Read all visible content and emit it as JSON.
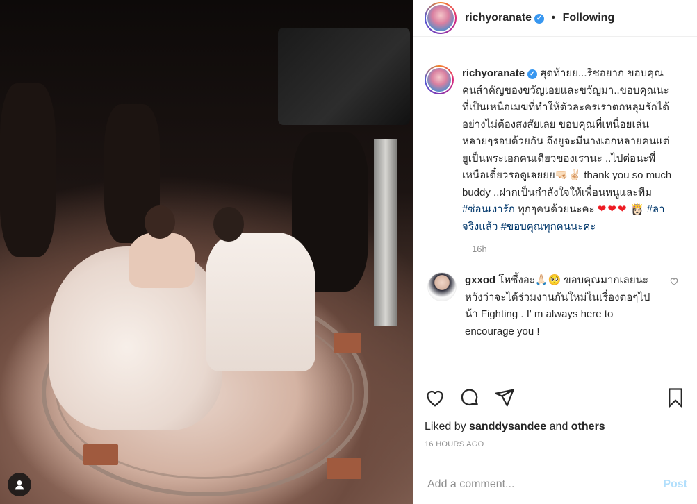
{
  "post": {
    "username": "richyoranate",
    "separator": "•",
    "follow_status": "Following",
    "verified_mark": "✓"
  },
  "caption": {
    "username": "richyoranate",
    "text_1": "สุดท้ายย...ริชอยาก ขอบคุณคนสำคัญของขวัญเอยและขวัญมา..ขอบคุณนะที่เป็นเหนือเมฆที่ทำให้ตัวละครเราตกหลุมรักได้อย่างไม่ต้องสงสัยเลย ขอบคุณที่เหนื่อยเล่นหลายๆรอบด้วยกัน ถึงยูจะมีนางเอกหลายคนแต่ยูเป็นพระเอกคนเดียวของเรานะ ..ไปต่อนะพี่เหนือเดี๋ยวรอดูเลยยย🤜🏻✌🏻 thank you so much buddy ..ฝากเป็นกำลังใจให้เพื่อนหนูและทีม ",
    "tag_1": "#ซ่อนเงารัก",
    "text_2": " ทุกๆคนด้วยนะคะ ",
    "hearts": "❤❤❤",
    "emoji_2": "👸🏻",
    "tag_2": "#ลาจริงแล้ว",
    "tag_3": "#ขอบคุณทุกคนนะคะ",
    "time": "16h"
  },
  "comment": {
    "username": "gxxod",
    "text": "โหซึ้งอะ🙏🏻🥺 ขอบคุณมากเลยนะหวังว่าจะได้ร่วมงานกันใหม่ในเรื่องต่อๆไปน้า Fighting . I' m always here to encourage you !"
  },
  "actions": {
    "liked_by_prefix": "Liked by ",
    "liked_by_user": "sanddysandee",
    "liked_and": " and ",
    "liked_others": "others",
    "timestamp": "16 HOURS AGO"
  },
  "add_comment": {
    "placeholder": "Add a comment...",
    "post_label": "Post"
  },
  "colors": {
    "link": "#00376b",
    "verified": "#3897f0",
    "post_disabled": "#b2dffc",
    "muted": "#8e8e8e"
  },
  "icons": [
    "heart-icon",
    "comment-icon",
    "share-icon",
    "bookmark-icon",
    "small-heart-icon",
    "user-icon",
    "verified-icon"
  ]
}
